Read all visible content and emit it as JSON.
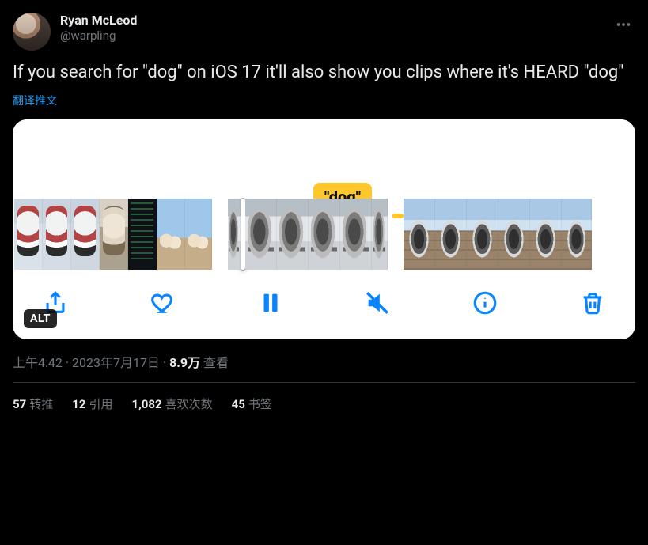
{
  "author": {
    "display_name": "Ryan McLeod",
    "handle": "@warpling"
  },
  "tweet_text": "If you search for \"dog\" on iOS 17 it'll also show you clips where it's HEARD \"dog\"",
  "translate_label": "翻译推文",
  "media": {
    "tooltip": "\"dog\"",
    "alt_badge": "ALT"
  },
  "meta": {
    "time": "上午4:42",
    "date": "2023年7月17日",
    "views_num": "8.9万",
    "views_label": "查看"
  },
  "stats": {
    "retweets_num": "57",
    "retweets_label": "转推",
    "quotes_num": "12",
    "quotes_label": "引用",
    "likes_num": "1,082",
    "likes_label": "喜欢次数",
    "bookmarks_num": "45",
    "bookmarks_label": "书签"
  }
}
